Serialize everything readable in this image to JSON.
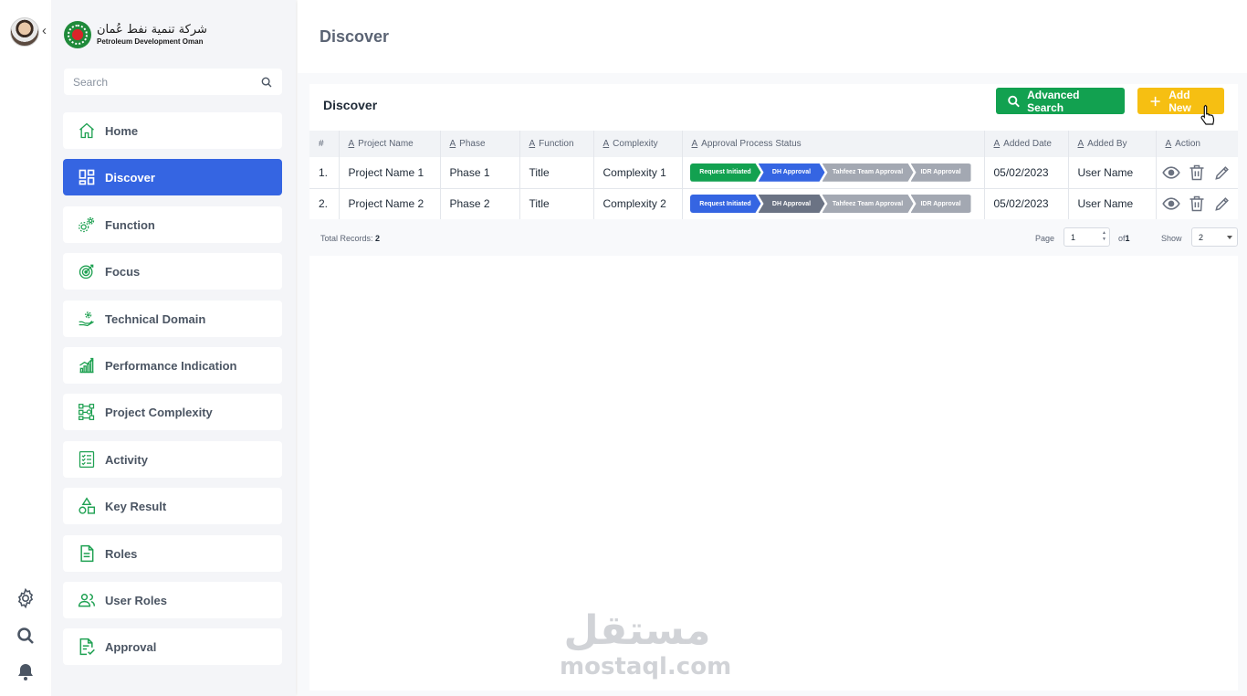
{
  "logo": {
    "arabic": "شركة تنمية نفط عُمان",
    "english": "Petroleum Development Oman"
  },
  "search": {
    "placeholder": "Search"
  },
  "nav": {
    "items": [
      {
        "label": "Home",
        "icon": "home-icon",
        "active": false
      },
      {
        "label": "Discover",
        "icon": "grid-icon",
        "active": true
      },
      {
        "label": "Function",
        "icon": "gears-icon",
        "active": false
      },
      {
        "label": "Focus",
        "icon": "target-icon",
        "active": false
      },
      {
        "label": "Technical Domain",
        "icon": "hand-gear-icon",
        "active": false
      },
      {
        "label": "Performance Indication",
        "icon": "growth-chart-icon",
        "active": false
      },
      {
        "label": "Project Complexity",
        "icon": "network-icon",
        "active": false
      },
      {
        "label": "Activity",
        "icon": "checklist-icon",
        "active": false
      },
      {
        "label": "Key Result",
        "icon": "shapes-icon",
        "active": false
      },
      {
        "label": "Roles",
        "icon": "document-icon",
        "active": false
      },
      {
        "label": "User Roles",
        "icon": "users-icon",
        "active": false
      },
      {
        "label": "Approval",
        "icon": "document-check-icon",
        "active": false
      }
    ]
  },
  "page": {
    "title": "Discover"
  },
  "card": {
    "title": "Discover",
    "advanced_search_label": "Advanced Search",
    "add_new_label": "Add New"
  },
  "table": {
    "columns": [
      "#",
      "Project Name",
      "Phase",
      "Function",
      "Complexity",
      "Approval Process Status",
      "Added Date",
      "Added By",
      "Action"
    ],
    "rows": [
      {
        "num": "1.",
        "project": "Project Name 1",
        "phase": "Phase 1",
        "function": "Title",
        "complexity": "Complexity 1",
        "added_date": "05/02/2023",
        "added_by": "User Name"
      },
      {
        "num": "2.",
        "project": "Project Name 2",
        "phase": "Phase 2",
        "function": "Title",
        "complexity": "Complexity 2",
        "added_date": "05/02/2023",
        "added_by": "User Name"
      }
    ],
    "approval_steps": [
      [
        "Request Initiated",
        "DH Approval",
        "Tahfeez Team Approval",
        "IDR Approval"
      ],
      [
        "Request Initiated",
        "DH Approval",
        "Tahfeez Team Approval",
        "IDR Approval"
      ]
    ],
    "step_colors": {
      "row1": [
        "#12a150",
        "#3565e2",
        "#a3a8b2",
        "#a3a8b2"
      ],
      "row2": [
        "#3565e2",
        "#6b7384",
        "#a3a8b2",
        "#a3a8b2"
      ]
    }
  },
  "footer": {
    "total_label": "Total Records:",
    "total_value": "2",
    "page_label": "Page",
    "page_value": "1",
    "of_label": "of",
    "of_value": "1",
    "show_label": "Show",
    "show_value": "2"
  },
  "watermark": {
    "arabic": "مستقل",
    "english": "mostaql.com"
  },
  "colors": {
    "primary": "#3565e2",
    "success": "#12a150",
    "warning": "#f6bf12",
    "icon_green": "#1fa152"
  }
}
